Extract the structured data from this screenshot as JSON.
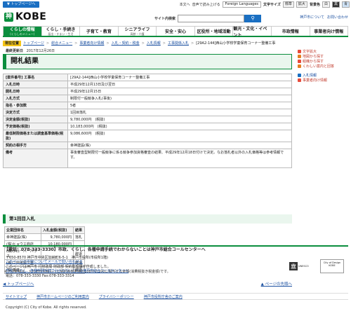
{
  "top": {
    "skip_label": "▼ トップページへ",
    "links": [
      "本文へ",
      "音声で読み上げる"
    ],
    "language": "Foreign Languages",
    "fontsize_label": "文字サイズ",
    "fontsize_options": [
      "標準",
      "拡大"
    ],
    "color_label": "背景色",
    "color_options": [
      "白",
      "黒",
      "青"
    ]
  },
  "header": {
    "logo_text": "KOBE",
    "logo_mark": "神",
    "search_label": "サイト内検索",
    "search_placeholder": "",
    "search_button": "⚲",
    "links": [
      "神戸市について",
      "お問い合わせ"
    ]
  },
  "gnav": [
    {
      "label": "くらしの情報",
      "sub": "(くらしのメニュー)"
    },
    {
      "label": "くらし・手続き",
      "sub": "届出・すまい・生活"
    },
    {
      "label": "子育て・教育",
      "sub": ""
    },
    {
      "label": "シニアライフ",
      "sub": "高齢・介護"
    },
    {
      "label": "安全・安心",
      "sub": ""
    },
    {
      "label": "区役所・地域活動",
      "sub": ""
    },
    {
      "label": "観光・文化・イベント",
      "sub": ""
    },
    {
      "label": "市政情報",
      "sub": ""
    },
    {
      "label": "事業者向け情報",
      "sub": ""
    }
  ],
  "breadcrumb": {
    "here": "現在位置",
    "items": [
      "トップページ",
      "総合メニュー",
      "事業者向け情報",
      "入札・契約・税金",
      "入札情報",
      "工事関係入札",
      "[29A2-144]西山小学校学童保育コーナー整備工事"
    ]
  },
  "updated": {
    "label": "最終更新日",
    "value": "2017年12月26日"
  },
  "title": "開札結果",
  "info_rows": [
    {
      "k": "[案件番号] 工事名",
      "v": "[29A2-144]西山小学校学童保育コーナー整備工事"
    },
    {
      "k": "入札日時",
      "v": "平成29年12月13日及び翌日"
    },
    {
      "k": "開札日時",
      "v": "平成29年12月15日"
    },
    {
      "k": "入札方式",
      "v": "制限付一般競争入札(事後)"
    },
    {
      "k": "指名・参加数",
      "v": "5者"
    },
    {
      "k": "決定方式",
      "v": "1回目落札"
    },
    {
      "k": "決定金額(税抜)",
      "v": "9,780,000円　(税抜)"
    },
    {
      "k": "予定価格(税抜)",
      "v": "10,183,000円　(税抜)"
    },
    {
      "k": "最低制限価格または調査基準価格(税抜)",
      "v": "9,086,600円　(税抜)"
    },
    {
      "k": "契約の相手方",
      "v": "幸神建設(株)"
    },
    {
      "k": "備考",
      "v": "事後審査型制限付一般競争に係る競争参加資格審査の結果、平成29年12月18日付けで決定。なお落札者以外の入札価格等は参考情報です。"
    }
  ],
  "round_title": "第1回目入札",
  "bid_headers": [
    "企業団体名",
    "入札金額(税抜)",
    "結果"
  ],
  "bids": [
    {
      "name": "幸神建設(株)",
      "amount": "9,780,000円",
      "result": "落札"
    },
    {
      "name": "(株)ヒョウエ商店",
      "amount": "10,180,000円",
      "result": ""
    },
    {
      "name": "(株)クローバーハウス",
      "amount": "",
      "result": "辞退"
    },
    {
      "name": "(株)三興建設工業",
      "amount": "",
      "result": "辞退"
    },
    {
      "name": "(株)蓬盛",
      "amount": "",
      "result": "辞退"
    }
  ],
  "note": "※上記金額は、入札者が見積もった契約希望金額の108分の100に相当する金額(消費税抜き税金額)です。",
  "pagenav": {
    "top": "トップページへ",
    "back": "ページの先頭へ"
  },
  "side": {
    "group1": [
      "文字拡大",
      "地図から探す",
      "組織から探す",
      "くわしい案内と回答"
    ],
    "group2": [
      "入札情報",
      "事業者向け情報"
    ]
  },
  "footer": {
    "call": "【電話：078-333-3330】市政、くらし、各種申請手続でわからないことは神戸市総合コールセンターへ",
    "addr_lines": [
      "〒650-8570 神戸市中央区加納町6-5-1　神戸市役所(市役所1階)",
      "このページの内容についてメールで問い合わせる",
      "このページは神戸市 行財政局 財政部 契約監理課が作成しました。",
      "市政、くらし、各種申請手続でわからないことは神戸市総合コールセンターへ",
      "電話：078-333-3330 Fax:078-333-3314"
    ],
    "badge1": "City of Design KOBE",
    "badge2": "UNESCO",
    "links": [
      "サイトマップ",
      "神戸市ホームページのご利用案内",
      "プライバシーポリシー",
      "神戸市役所庁舎のご案内"
    ],
    "copyright": "Copyright (C) City of Kobe. All rights reserved."
  },
  "colors": {
    "accent": "#0b8e3e",
    "link": "#1a4fa0",
    "highlight": "#f5c518"
  }
}
